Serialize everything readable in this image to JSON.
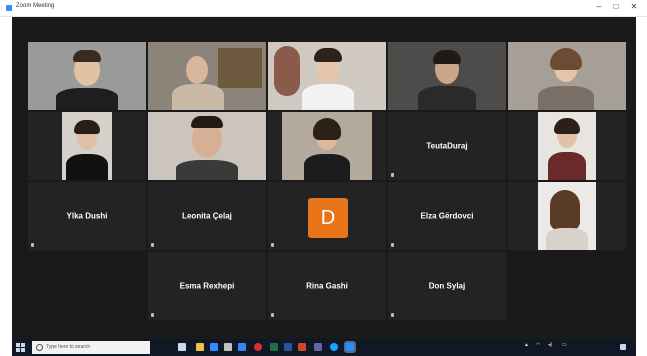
{
  "window": {
    "title": "Zoom Meeting",
    "controls": {
      "minimize": "–",
      "maximize": "□",
      "close": "✕"
    }
  },
  "participants": {
    "teuta": "TeutaDuraj",
    "ylka": "Ylka Dushi",
    "leonita": "Leonita Çelaj",
    "elza": "Elza Gërdovci",
    "esma": "Esma Rexhepi",
    "rina": "Rina Gashi",
    "don": "Don Sylaj",
    "avatar_letter": "D"
  },
  "taskbar": {
    "search_placeholder": "Type here to search"
  },
  "colors": {
    "active_speaker": "#a3c93a",
    "avatar": "#e8751a",
    "stage_bg": "#1a1a1a",
    "tile_bg": "#232323"
  }
}
